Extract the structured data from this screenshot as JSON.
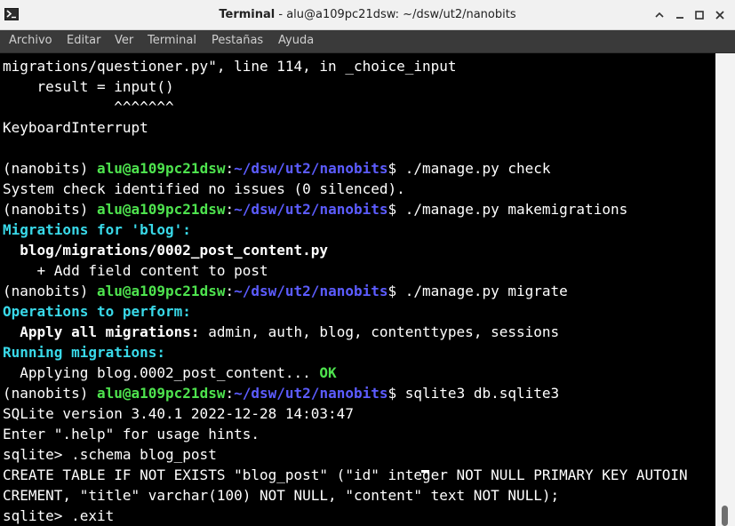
{
  "window": {
    "title_app": "Terminal",
    "title_sep": " - ",
    "title_host": "alu@a109pc21dsw: ~/dsw/ut2/nanobits"
  },
  "menu": {
    "items": [
      "Archivo",
      "Editar",
      "Ver",
      "Terminal",
      "Pestañas",
      "Ayuda"
    ]
  },
  "terminal": {
    "lines": [
      [
        {
          "t": "migrations/questioner.py\", line 114, in _choice_input",
          "c": ""
        }
      ],
      [
        {
          "t": "    result = input()",
          "c": ""
        }
      ],
      [
        {
          "t": "             ^^^^^^^",
          "c": ""
        }
      ],
      [
        {
          "t": "KeyboardInterrupt",
          "c": ""
        }
      ],
      [
        {
          "t": "",
          "c": ""
        }
      ],
      [
        {
          "t": "(nanobits) ",
          "c": ""
        },
        {
          "t": "alu@a109pc21dsw",
          "c": "g"
        },
        {
          "t": ":",
          "c": ""
        },
        {
          "t": "~/dsw/ut2/nanobits",
          "c": "b"
        },
        {
          "t": "$ ./manage.py check",
          "c": ""
        }
      ],
      [
        {
          "t": "System check identified no issues (0 silenced).",
          "c": ""
        }
      ],
      [
        {
          "t": "(nanobits) ",
          "c": ""
        },
        {
          "t": "alu@a109pc21dsw",
          "c": "g"
        },
        {
          "t": ":",
          "c": ""
        },
        {
          "t": "~/dsw/ut2/nanobits",
          "c": "b"
        },
        {
          "t": "$ ./manage.py makemigrations",
          "c": ""
        }
      ],
      [
        {
          "t": "Migrations for 'blog':",
          "c": "c"
        }
      ],
      [
        {
          "t": "  ",
          "c": ""
        },
        {
          "t": "blog/migrations/0002_post_content.py",
          "c": "w"
        }
      ],
      [
        {
          "t": "    + Add field content to post",
          "c": ""
        }
      ],
      [
        {
          "t": "(nanobits) ",
          "c": ""
        },
        {
          "t": "alu@a109pc21dsw",
          "c": "g"
        },
        {
          "t": ":",
          "c": ""
        },
        {
          "t": "~/dsw/ut2/nanobits",
          "c": "b"
        },
        {
          "t": "$ ./manage.py migrate",
          "c": ""
        }
      ],
      [
        {
          "t": "Operations to perform:",
          "c": "c"
        }
      ],
      [
        {
          "t": "  ",
          "c": ""
        },
        {
          "t": "Apply all migrations:",
          "c": "w"
        },
        {
          "t": " admin, auth, blog, contenttypes, sessions",
          "c": ""
        }
      ],
      [
        {
          "t": "Running migrations:",
          "c": "c"
        }
      ],
      [
        {
          "t": "  Applying blog.0002_post_content... ",
          "c": ""
        },
        {
          "t": "OK",
          "c": "g"
        }
      ],
      [
        {
          "t": "(nanobits) ",
          "c": ""
        },
        {
          "t": "alu@a109pc21dsw",
          "c": "g"
        },
        {
          "t": ":",
          "c": ""
        },
        {
          "t": "~/dsw/ut2/nanobits",
          "c": "b"
        },
        {
          "t": "$ sqlite3 db.sqlite3",
          "c": ""
        }
      ],
      [
        {
          "t": "SQLite version 3.40.1 2022-12-28 14:03:47",
          "c": ""
        }
      ],
      [
        {
          "t": "Enter \".help\" for usage hints.",
          "c": ""
        }
      ],
      [
        {
          "t": "sqlite> .schema blog_post",
          "c": ""
        }
      ],
      [
        {
          "t": "CREATE TABLE IF NOT EXISTS \"blog_post\" (\"id\" integer NOT NULL PRIMARY KEY AUTOIN",
          "c": ""
        }
      ],
      [
        {
          "t": "CREMENT, \"title\" varchar(100) NOT NULL, \"content\" text NOT NULL);",
          "c": ""
        }
      ],
      [
        {
          "t": "sqlite> .exit",
          "c": ""
        }
      ]
    ]
  },
  "colors": {
    "terminal_bg": "#000000",
    "text": "#ffffff",
    "user_host": "#4ee34e",
    "path": "#5c5cff",
    "heading": "#39d9e9",
    "menubar_bg": "#3a3a3a",
    "titlebar_bg": "#f1f1f1"
  },
  "icons": {
    "app": "terminal-app-icon",
    "maximize_alt": "chevron-up-icon",
    "minimize": "minimize-icon",
    "maximize": "maximize-icon",
    "close": "close-icon"
  }
}
